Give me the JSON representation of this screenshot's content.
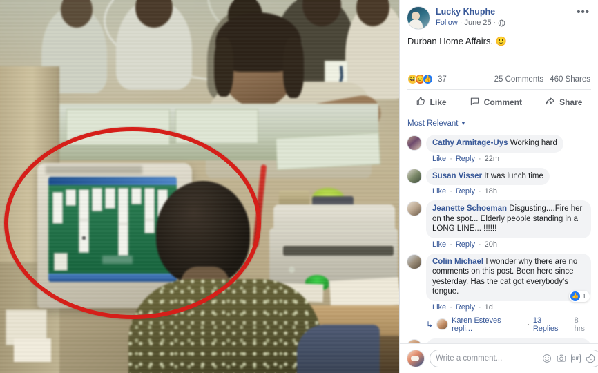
{
  "post": {
    "author": "Lucky Khuphe",
    "follow_label": "Follow",
    "date": "June 25",
    "privacy_icon": "globe-icon",
    "menu_icon": "ellipsis-icon",
    "text": "Durban Home Affairs.",
    "text_emoji": "🙂",
    "reactions": {
      "types": [
        "haha",
        "angry",
        "like"
      ],
      "count": "37",
      "comments_count": "25 Comments",
      "shares_count": "460 Shares"
    },
    "actions": [
      {
        "label": "Like",
        "icon": "thumbs-up-icon"
      },
      {
        "label": "Comment",
        "icon": "comment-bubble-icon"
      },
      {
        "label": "Share",
        "icon": "share-arrow-icon"
      }
    ],
    "sort_label": "Most Relevant"
  },
  "comments": [
    {
      "name": "Cathy Armitage-Uys",
      "text": "Working hard",
      "like": "Like",
      "reply": "Reply",
      "time": "22m"
    },
    {
      "name": "Susan Visser",
      "text": "It was lunch time",
      "like": "Like",
      "reply": "Reply",
      "time": "18h"
    },
    {
      "name": "Jeanette Schoeman",
      "text": "Disgusting....Fire her on the spot... Elderly people standing in a LONG LINE... !!!!!!",
      "like": "Like",
      "reply": "Reply",
      "time": "20h"
    },
    {
      "name": "Colin Michael",
      "text": "I wonder why there are no comments on this post. Been here since yesterday. Has the cat got everybody's tongue.",
      "like": "Like",
      "reply": "Reply",
      "time": "1d",
      "like_badge_count": "1"
    }
  ],
  "reply_row": {
    "name": "Karen Esteves repli...",
    "separator": "·",
    "count": "13 Replies",
    "time": "8 hrs"
  },
  "composer": {
    "placeholder": "Write a comment...",
    "value": "",
    "icons": [
      "emoji-icon",
      "camera-icon",
      "gif-icon",
      "sticker-icon"
    ],
    "gif_label": "GIF"
  },
  "photo": {
    "description": "Government office counter with clerk at CRT monitor playing solitaire",
    "annotation": "red-ellipse-highlight",
    "annotation_color": "#d51f19"
  },
  "colors": {
    "fb_link": "#385898",
    "fb_blue": "#2078f4",
    "text_primary": "#1c1e21",
    "text_muted": "#616770",
    "bubble_bg": "#f2f3f5",
    "divider": "#e5e7ea"
  }
}
